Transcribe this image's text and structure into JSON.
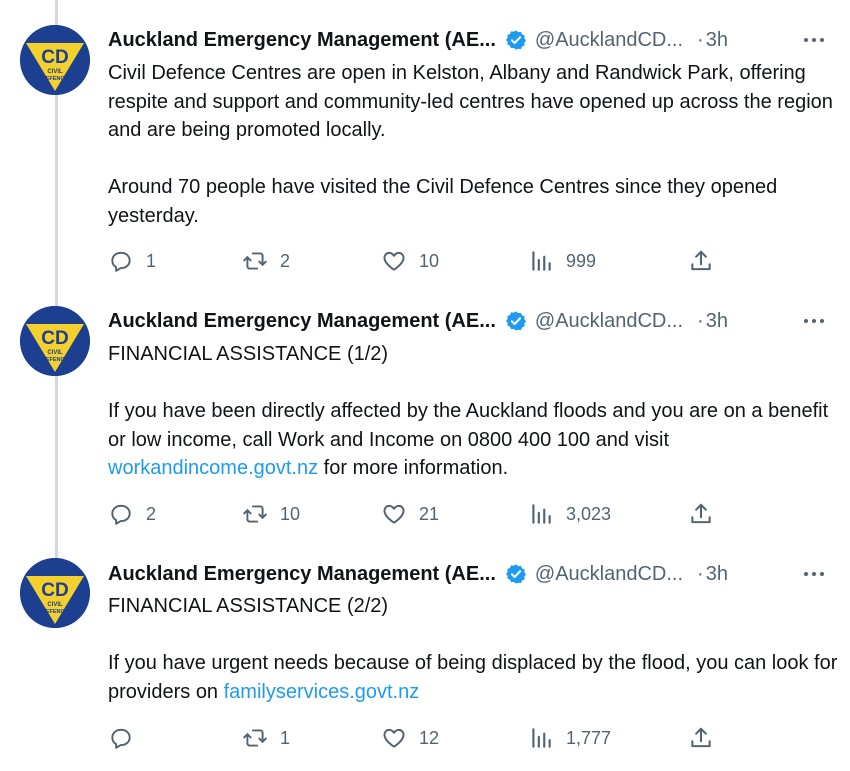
{
  "author": {
    "name": "Auckland Emergency Management (AE...",
    "handle": "@AucklandCD...",
    "avatar_text_top": "CD",
    "avatar_text_bottom": "CIVIL DEFENCE"
  },
  "colors": {
    "verified": "#1d9bf0",
    "link": "#1d9bf0",
    "muted": "#536471",
    "avatar_blue": "#1c3f8f",
    "avatar_yellow": "#f3d02d"
  },
  "icons": [
    "reply-icon",
    "retweet-icon",
    "like-icon",
    "views-icon",
    "share-icon",
    "more-icon",
    "verified-badge-icon"
  ],
  "tweets": [
    {
      "time": "3h",
      "paragraphs": [
        "Civil Defence Centres are open in Kelston, Albany and Randwick Park, offering respite and support and community-led centres have opened up across the region and are being promoted locally.",
        "Around 70 people have visited the Civil Defence Centres since they opened yesterday."
      ],
      "replies": "1",
      "retweets": "2",
      "likes": "10",
      "views": "999"
    },
    {
      "time": "3h",
      "title": "FINANCIAL ASSISTANCE (1/2)",
      "body_before_link": "If you have been directly affected by the Auckland floods and you are on a benefit or low income, call Work and Income on 0800 400 100 and visit ",
      "link": "workandincome.govt.nz",
      "body_after_link": " for more information.",
      "replies": "2",
      "retweets": "10",
      "likes": "21",
      "views": "3,023"
    },
    {
      "time": "3h",
      "title": "FINANCIAL ASSISTANCE (2/2)",
      "body_before_link": "If you have urgent needs because of being displaced by the flood, you can look for providers on ",
      "link": "familyservices.govt.nz",
      "body_after_link": "",
      "replies": "",
      "retweets": "1",
      "likes": "12",
      "views": "1,777"
    }
  ]
}
